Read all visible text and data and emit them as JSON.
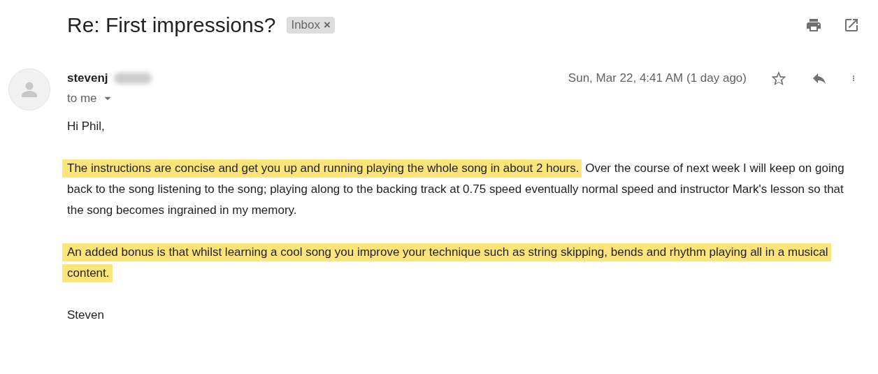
{
  "subject": "Re: First impressions?",
  "labels": [
    {
      "text": "Inbox",
      "close": "×"
    }
  ],
  "message": {
    "sender": "stevenj",
    "recipient": "to me",
    "date": "Sun, Mar 22, 4:41 AM (1 day ago)",
    "starred": false,
    "body": [
      {
        "kind": "plain",
        "segments": [
          {
            "text": "Hi Phil,",
            "highlighted": false
          }
        ]
      },
      {
        "kind": "plain",
        "segments": [
          {
            "text": "The instructions are concise and get you up and running playing the whole song in about 2 hours.",
            "highlighted": true
          },
          {
            "text": " Over the course of next week I will keep on going back to the song listening to the song; playing along to the backing track at 0.75 speed eventually normal speed and instructor Mark's lesson so that the song becomes ingrained in my memory.",
            "highlighted": false
          }
        ]
      },
      {
        "kind": "plain",
        "segments": [
          {
            "text": "An added bonus is that whilst learning a cool song you improve your technique such as string skipping, bends and rhythm playing all in a musical content.",
            "highlighted": true
          }
        ]
      },
      {
        "kind": "plain",
        "segments": [
          {
            "text": "Steven",
            "highlighted": false
          }
        ]
      }
    ]
  }
}
